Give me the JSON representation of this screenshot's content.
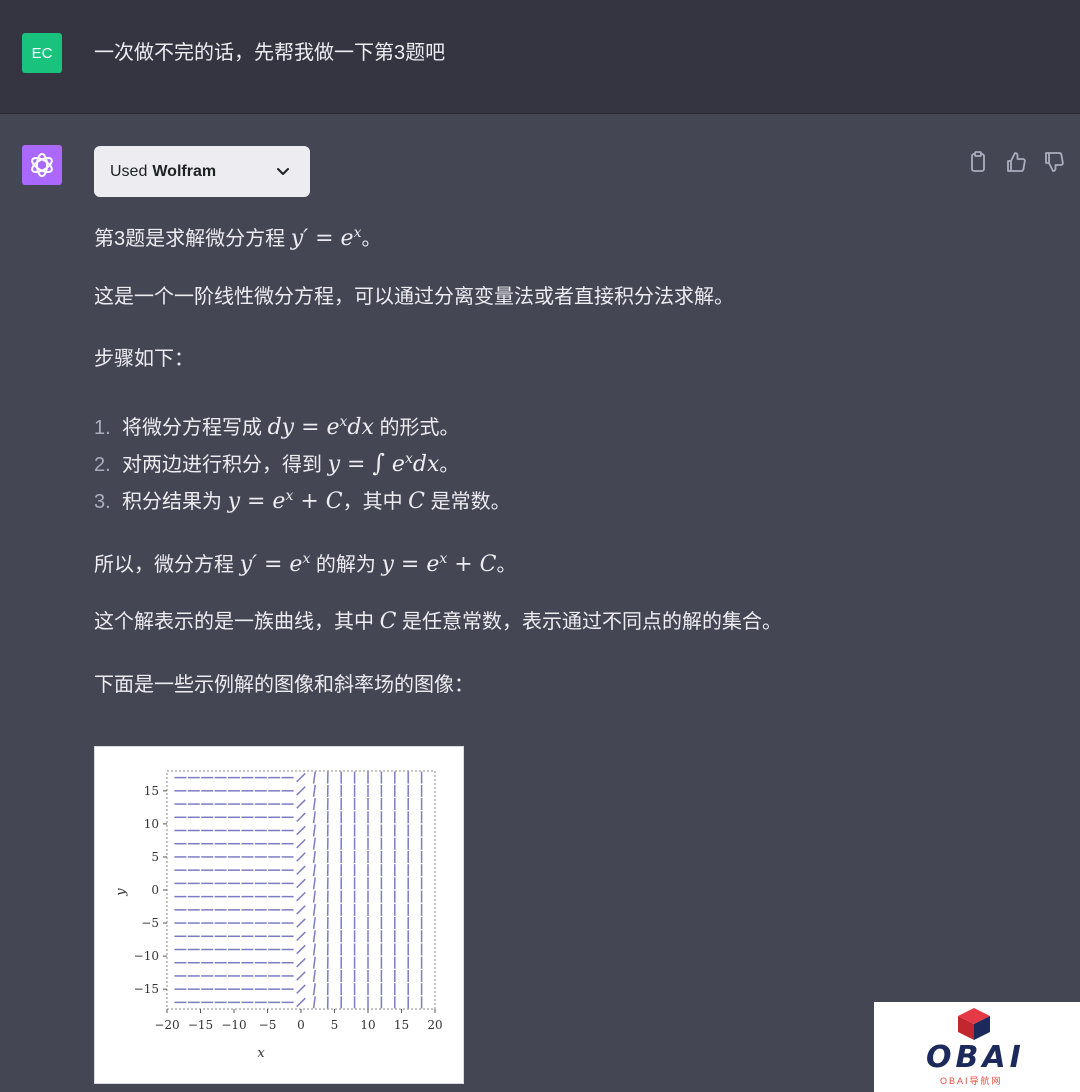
{
  "user_message": {
    "avatar_initials": "EC",
    "text": "一次做不完的话，先帮我做一下第3题吧"
  },
  "assistant": {
    "plugin": {
      "used_label": "Used",
      "plugin_name": "Wolfram"
    },
    "actions": [
      "copy-icon",
      "thumbs-up-icon",
      "thumbs-down-icon"
    ],
    "p1_text": "第3题是求解微分方程 ",
    "p1_math": "y′ = e",
    "p1_sup": "x",
    "p1_end": "。",
    "p2": "这是一个一阶线性微分方程，可以通过分离变量法或者直接积分法求解。",
    "p3": "步骤如下：",
    "steps": [
      {
        "num": "1.",
        "pre": "将微分方程写成 ",
        "math": "dy = e",
        "sup": "x",
        "math2": "dx",
        "post": " 的形式。"
      },
      {
        "num": "2.",
        "pre": "对两边进行积分，得到 ",
        "math": "y = ",
        "integral": "∫",
        "math_b": " e",
        "sup": "x",
        "math2": "dx",
        "post": "。"
      },
      {
        "num": "3.",
        "pre": "积分结果为 ",
        "math": "y = e",
        "sup": "x",
        "math2": " + C",
        "mid": "，其中 ",
        "c": "C",
        "post": " 是常数。"
      }
    ],
    "p4_pre": "所以，微分方程 ",
    "p4_math1": "y′ = e",
    "p4_sup1": "x",
    "p4_mid": " 的解为 ",
    "p4_math2": "y = e",
    "p4_sup2": "x",
    "p4_math3": " + C",
    "p4_end": "。",
    "p5_pre": "这个解表示的是一族曲线，其中 ",
    "p5_c": "C",
    "p5_post": " 是任意常数，表示通过不同点的解的集合。",
    "p6": "下面是一些示例解的图像和斜率场的图像："
  },
  "chart_data": {
    "type": "slope-field",
    "function": "dy/dx = e^x",
    "xlabel": "x",
    "ylabel": "y",
    "xlim": [
      -20,
      20
    ],
    "ylim": [
      -18,
      18
    ],
    "x_ticks": [
      -20,
      -15,
      -10,
      -5,
      0,
      5,
      10,
      15,
      20
    ],
    "y_ticks": [
      -15,
      -10,
      -5,
      0,
      5,
      10,
      15
    ],
    "grid_x": [
      -18,
      -16,
      -14,
      -12,
      -10,
      -8,
      -6,
      -4,
      -2,
      0,
      2,
      4,
      6,
      8,
      10,
      12,
      14,
      16,
      18
    ],
    "grid_y": [
      -17,
      -15,
      -13,
      -11,
      -9,
      -7,
      -5,
      -3,
      -1,
      1,
      3,
      5,
      7,
      9,
      11,
      13,
      15,
      17
    ],
    "color": "#7c7cc4"
  },
  "watermark": {
    "title": "OBAI",
    "subtitle": "OBAI导航网"
  },
  "colors": {
    "bg": "#444654",
    "user_bg": "#343541",
    "user_avatar": "#19c37d",
    "bot_avatar": "#ab68ff"
  }
}
